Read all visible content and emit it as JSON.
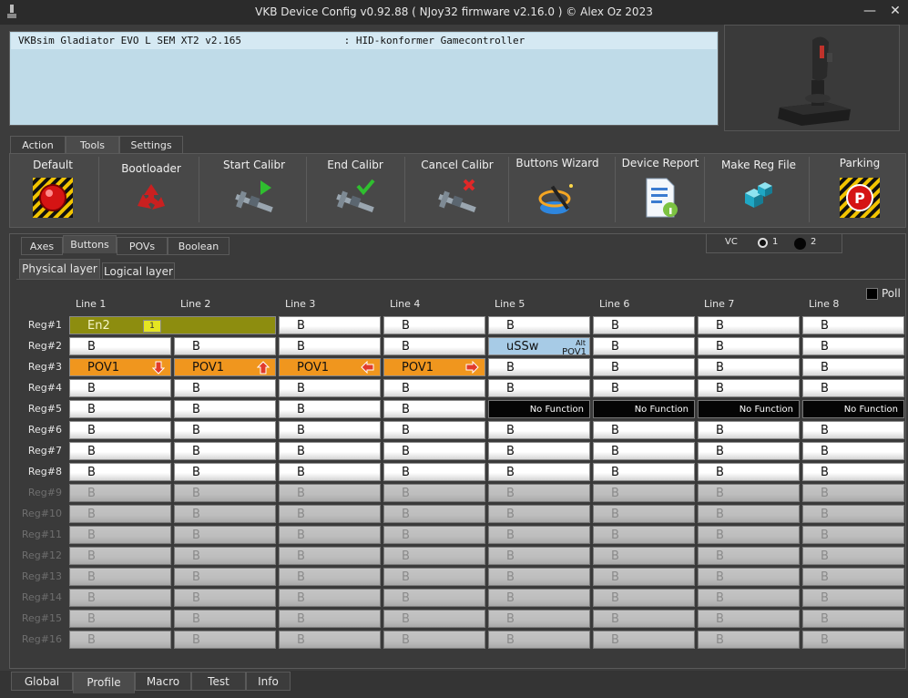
{
  "title": "VKB Device Config v0.92.88 ( NJoy32 firmware v2.16.0 ) © Alex Oz 2023",
  "window_controls": {
    "minimize": "—",
    "close": "✕"
  },
  "device": {
    "row": "VKBsim Gladiator EVO L SEM XT2 v2.165                 : HID-konformer Gamecontroller"
  },
  "top_tabs": [
    "Action",
    "Tools",
    "Settings"
  ],
  "tools": [
    {
      "label": "Default",
      "icon": "default-record-icon"
    },
    {
      "label": "Bootloader",
      "icon": "recycle-icon"
    },
    {
      "label": "Start Calibr",
      "icon": "caliper-play-icon"
    },
    {
      "label": "End Calibr",
      "icon": "caliper-check-icon"
    },
    {
      "label": "Cancel Calibr",
      "icon": "caliper-cancel-icon"
    },
    {
      "label": "Buttons Wizard",
      "icon": "wizard-wand-icon"
    },
    {
      "label": "Device Report",
      "icon": "report-info-icon"
    },
    {
      "label": "Make Reg File",
      "icon": "registry-cubes-icon"
    },
    {
      "label": "Parking",
      "icon": "parking-icon"
    }
  ],
  "mid_tabs": [
    "Axes",
    "Buttons",
    "POVs",
    "Boolean"
  ],
  "vc": {
    "label": "VC",
    "opt1": "1",
    "opt2": "2"
  },
  "layer_tabs": [
    "Physical layer",
    "Logical layer"
  ],
  "poll_label": "Poll",
  "columns": [
    "Line 1",
    "Line 2",
    "Line 3",
    "Line 4",
    "Line 5",
    "Line 6",
    "Line 7",
    "Line 8"
  ],
  "rows": [
    "Reg#1",
    "Reg#2",
    "Reg#3",
    "Reg#4",
    "Reg#5",
    "Reg#6",
    "Reg#7",
    "Reg#8",
    "Reg#9",
    "Reg#10",
    "Reg#11",
    "Reg#12",
    "Reg#13",
    "Reg#14",
    "Reg#15",
    "Reg#16"
  ],
  "cells": {
    "B": "B",
    "no_function": "No Function",
    "en2": "En2",
    "en2_badge": "1",
    "pov": "POV1",
    "ussw": "uSSw",
    "ussw_alt": "Alt",
    "ussw_pov": "POV1"
  },
  "colors": {
    "pov": "#f0961e",
    "encoder": "#8d8d0f",
    "microswitch": "#a7cbe6",
    "no_function": "#050505"
  },
  "bottom_tabs": [
    "Global",
    "Profile",
    "Macro",
    "Test",
    "Info"
  ]
}
